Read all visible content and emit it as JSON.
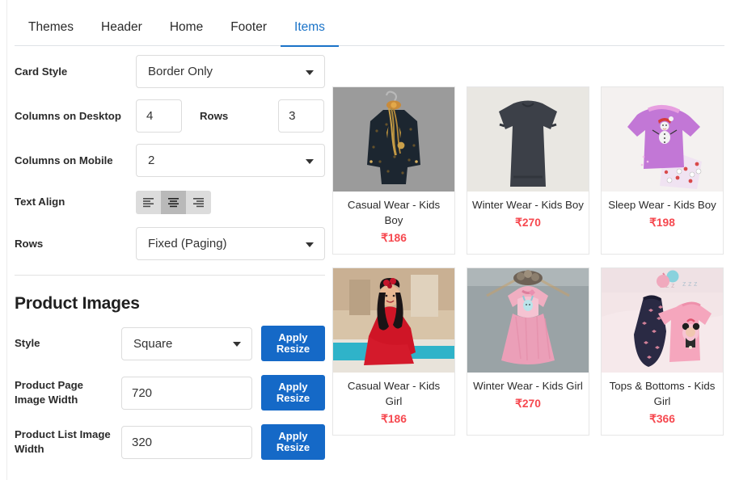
{
  "tabs": [
    {
      "label": "Themes",
      "active": false
    },
    {
      "label": "Header",
      "active": false
    },
    {
      "label": "Home",
      "active": false
    },
    {
      "label": "Footer",
      "active": false
    },
    {
      "label": "Items",
      "active": true
    }
  ],
  "settings": {
    "card_style": {
      "label": "Card Style",
      "value": "Border Only"
    },
    "columns_desktop": {
      "label": "Columns on Desktop",
      "value": "4"
    },
    "rows_inline": {
      "label": "Rows",
      "value": "3"
    },
    "columns_mobile": {
      "label": "Columns on Mobile",
      "value": "2"
    },
    "text_align": {
      "label": "Text Align",
      "options": [
        "align-left",
        "align-center",
        "align-right"
      ],
      "selected": "align-center"
    },
    "rows": {
      "label": "Rows",
      "value": "Fixed (Paging)"
    }
  },
  "product_images": {
    "title": "Product Images",
    "style": {
      "label": "Style",
      "value": "Square",
      "button": "Apply\nResize"
    },
    "page_image_width": {
      "label": "Product Page Image Width",
      "value": "720",
      "button": "Apply\nResize"
    },
    "list_image_width": {
      "label": "Product List Image Width",
      "value": "320",
      "button": "Apply\nResize"
    },
    "apply_label_line1": "Apply",
    "apply_label_line2": "Resize"
  },
  "colors": {
    "accent": "#1a73c8",
    "button": "#1569c7",
    "price": "#f6484f"
  },
  "products": [
    {
      "title": "Casual Wear - Kids Boy",
      "price": "₹186",
      "image": "kids-boy-sherwani"
    },
    {
      "title": "Winter Wear - Kids Boy",
      "price": "₹270",
      "image": "kids-boy-sweater"
    },
    {
      "title": "Sleep Wear - Kids Boy",
      "price": "₹198",
      "image": "kids-boy-pyjama-set"
    },
    {
      "title": "Casual Wear - Kids Girl",
      "price": "₹186",
      "image": "kids-girl-red-dress"
    },
    {
      "title": "Winter Wear - Kids Girl",
      "price": "₹270",
      "image": "kids-girl-pink-dress"
    },
    {
      "title": "Tops & Bottoms - Kids Girl",
      "price": "₹366",
      "image": "kids-girl-top-and-pants"
    }
  ]
}
